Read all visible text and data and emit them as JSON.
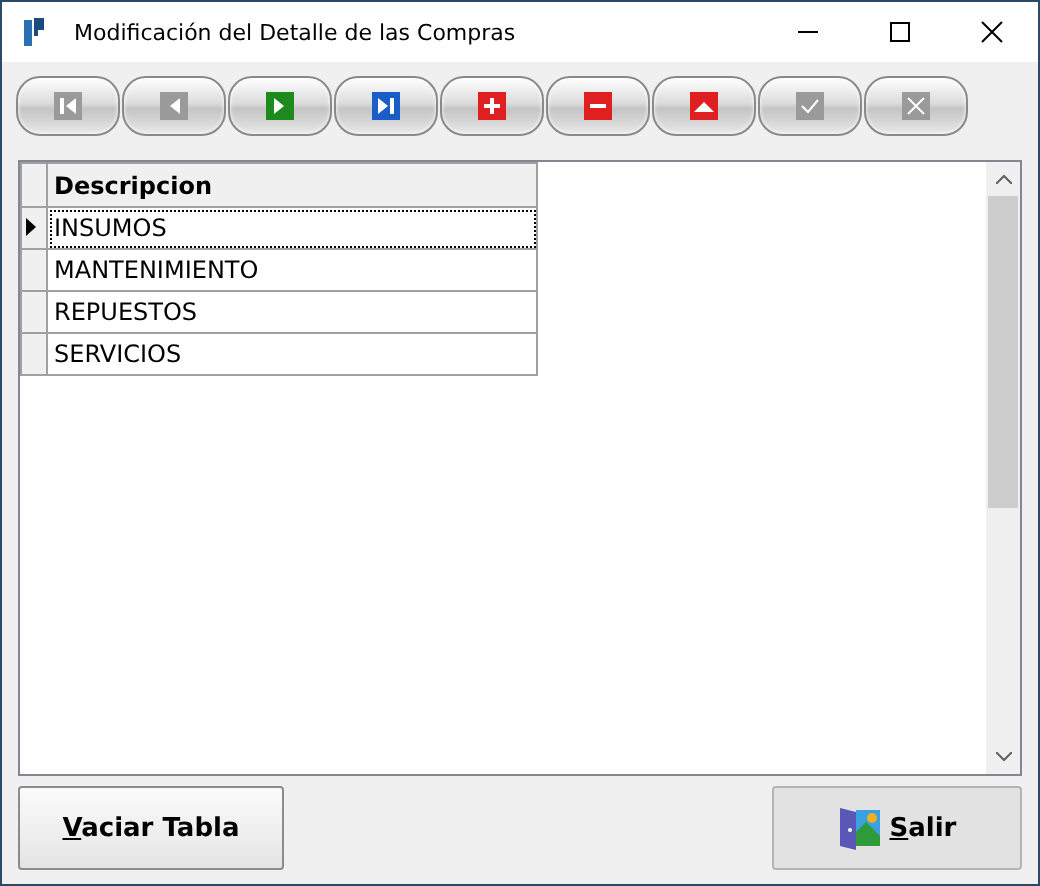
{
  "window": {
    "title": "Modificación del Detalle de las Compras"
  },
  "toolbar": [
    {
      "kind": "first",
      "disabled": true
    },
    {
      "kind": "prev",
      "disabled": true
    },
    {
      "kind": "next",
      "disabled": false
    },
    {
      "kind": "last",
      "disabled": false
    },
    {
      "kind": "add",
      "disabled": false
    },
    {
      "kind": "delete",
      "disabled": false
    },
    {
      "kind": "edit",
      "disabled": false
    },
    {
      "kind": "confirm",
      "disabled": true
    },
    {
      "kind": "cancel",
      "disabled": true
    }
  ],
  "table": {
    "columns": [
      "Descripcion"
    ],
    "rows": [
      {
        "cells": [
          "INSUMOS"
        ],
        "selected": true
      },
      {
        "cells": [
          "MANTENIMIENTO"
        ],
        "selected": false
      },
      {
        "cells": [
          "REPUESTOS"
        ],
        "selected": false
      },
      {
        "cells": [
          "SERVICIOS"
        ],
        "selected": false
      }
    ]
  },
  "buttons": [
    {
      "kind": "plain",
      "label": "Vaciar Tabla",
      "first_letter_underlined": true
    },
    {
      "kind": "exit",
      "label": "Salir",
      "first_letter_underlined": true
    }
  ]
}
